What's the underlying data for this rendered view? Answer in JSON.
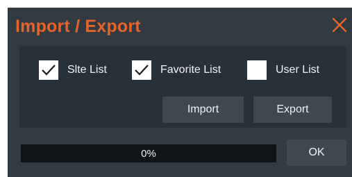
{
  "dialog": {
    "title": "Import / Export",
    "title_color": "#e8632a",
    "background": "#313a41",
    "close_icon": "close-icon"
  },
  "options": [
    {
      "label": "Slte List",
      "checked": true
    },
    {
      "label": "Favorite List",
      "checked": true
    },
    {
      "label": "User List",
      "checked": false
    }
  ],
  "buttons": {
    "import_label": "Import",
    "export_label": "Export",
    "ok_label": "OK"
  },
  "progress": {
    "text": "0%",
    "value": 0
  }
}
